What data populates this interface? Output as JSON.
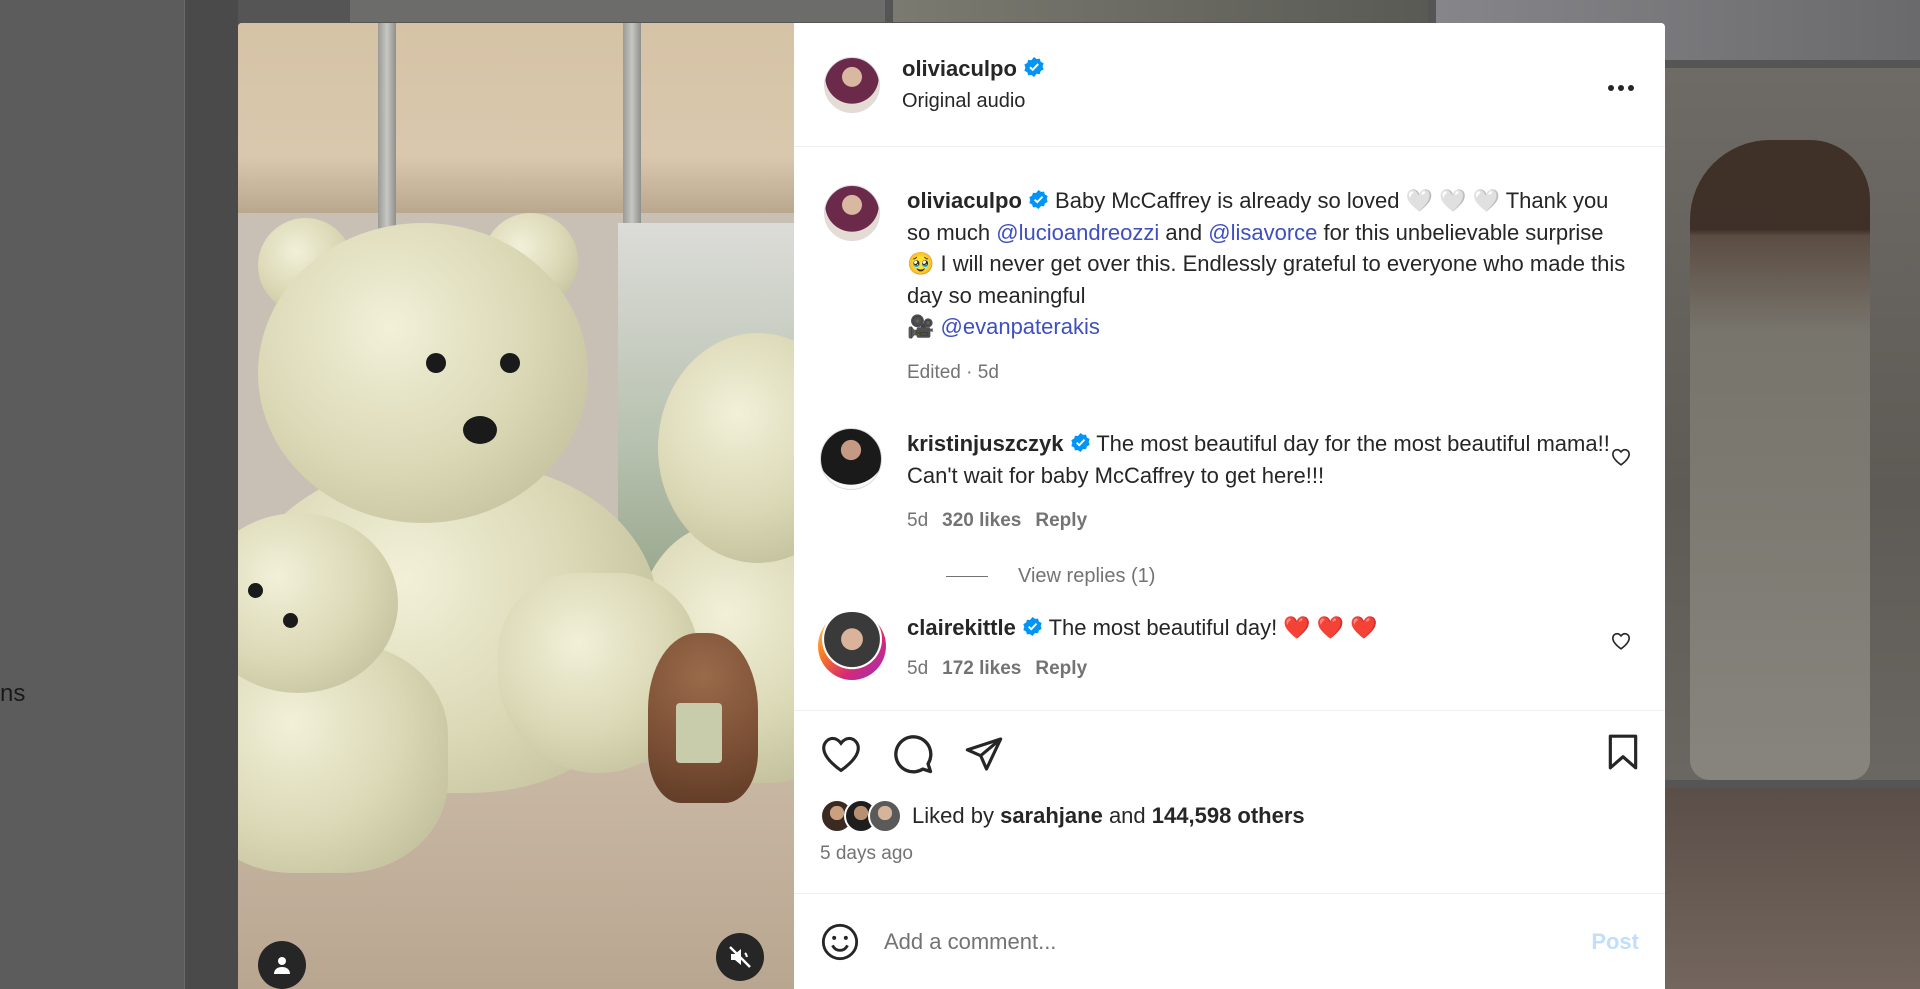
{
  "background": {
    "nav_fragment": "ns"
  },
  "post": {
    "author": "oliviaculpo",
    "audio": "Original audio",
    "caption": {
      "author": "oliviaculpo",
      "text_1": "Baby McCaffrey is already so loved 🤍 🤍 🤍 Thank you so much",
      "mention_1": "@lucioandreozzi",
      "text_2": "and",
      "mention_2": "@lisavorce",
      "text_3": "for this unbelievable surprise 🥹 I will never get over this. Endlessly grateful to everyone who made this day so meaningful",
      "camera": "🎥",
      "mention_3": "@evanpaterakis",
      "meta": "Edited · 5d"
    },
    "comments": [
      {
        "author": "kristinjuszczyk",
        "text": "The most beautiful day for the most beautiful mama!! Can't wait for baby McCaffrey to get here!!!",
        "time": "5d",
        "likes": "320 likes",
        "reply": "Reply",
        "view_replies": "View replies (1)"
      },
      {
        "author": "clairekittle",
        "text": "The most beautiful day! ❤️ ❤️ ❤️",
        "time": "5d",
        "likes": "172 likes",
        "reply": "Reply"
      }
    ],
    "likes": {
      "prefix": "Liked by",
      "user": "sarahjane",
      "and": "and",
      "others": "144,598 others"
    },
    "posted_ago": "5 days ago",
    "comment_box": {
      "placeholder": "Add a comment...",
      "post_label": "Post"
    }
  },
  "colors": {
    "verified": "#0095f6",
    "mention": "#3e4fbf",
    "post_disabled": "#c0dffd"
  }
}
